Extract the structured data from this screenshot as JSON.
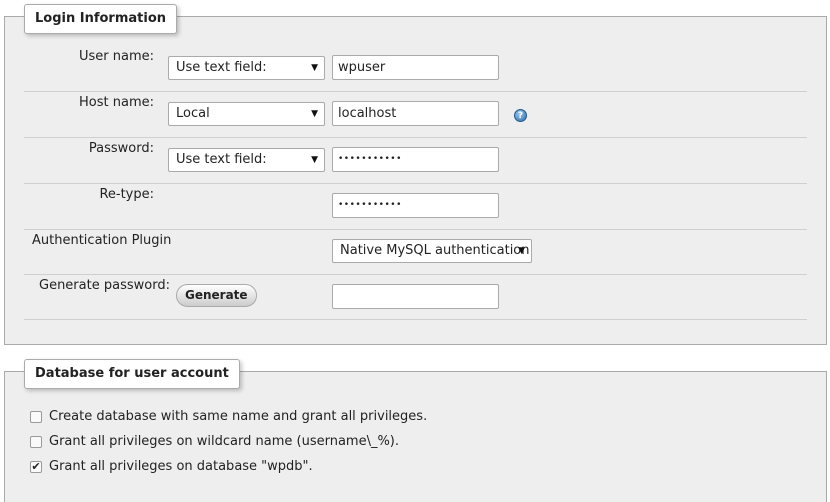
{
  "login_info": {
    "legend": "Login Information",
    "user_name": {
      "label": "User name:",
      "select": "Use text field:",
      "value": "wpuser"
    },
    "host_name": {
      "label": "Host name:",
      "select": "Local",
      "value": "localhost",
      "help_icon": "help-icon"
    },
    "password": {
      "label": "Password:",
      "select": "Use text field:",
      "value": "•••••••••••"
    },
    "retype": {
      "label": "Re-type:",
      "value": "•••••••••••"
    },
    "auth_plugin": {
      "label": "Authentication Plugin",
      "select": "Native MySQL authentication"
    },
    "generate": {
      "label": "Generate password:",
      "button": "Generate",
      "value": ""
    }
  },
  "db_account": {
    "legend": "Database for user account",
    "options": [
      {
        "label": "Create database with same name and grant all privileges.",
        "checked": false
      },
      {
        "label": "Grant all privileges on wildcard name (username\\_%).",
        "checked": false
      },
      {
        "label": "Grant all privileges on database \"wpdb\".",
        "checked": true
      }
    ]
  }
}
